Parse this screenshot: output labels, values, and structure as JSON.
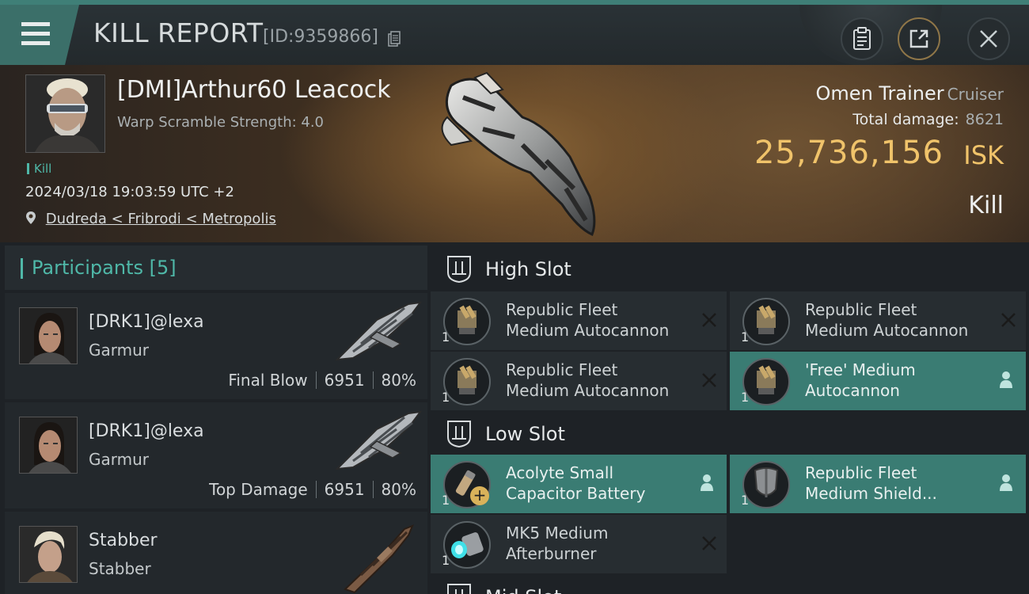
{
  "header": {
    "title": "KILL REPORT",
    "id_text": "[ID:9359866]"
  },
  "victim": {
    "name": "[DMI]Arthur60 Leacock",
    "warp_scramble": "Warp Scramble Strength: 4.0",
    "tag": "Kill",
    "datetime": "2024/03/18 19:03:59 UTC +2",
    "location": "Dudreda < Fribrodi < Metropolis",
    "ship": "Omen Trainer",
    "ship_class": "Cruiser",
    "total_damage_label": "Total damage:",
    "total_damage": "8621",
    "isk_value": "25,736,156",
    "isk_unit": "ISK",
    "result": "Kill"
  },
  "participants": {
    "title": "Participants",
    "count": "[5]",
    "rows": [
      {
        "name": "[DRK1]@lexa",
        "ship": "Garmur",
        "role": "Final Blow",
        "damage": "6951",
        "percent": "80%"
      },
      {
        "name": "[DRK1]@lexa",
        "ship": "Garmur",
        "role": "Top Damage",
        "damage": "6951",
        "percent": "80%"
      },
      {
        "name": "Stabber",
        "ship": "Stabber",
        "role": "",
        "damage": "",
        "percent": ""
      }
    ]
  },
  "slots": {
    "high_title": "High Slot",
    "low_title": "Low Slot",
    "mid_title": "Mid Slot",
    "high": [
      {
        "qty": "1",
        "line1": "Republic Fleet",
        "line2": "Medium Autocannon",
        "state": "destroyed"
      },
      {
        "qty": "1",
        "line1": "Republic Fleet",
        "line2": "Medium Autocannon",
        "state": "destroyed"
      },
      {
        "qty": "1",
        "line1": "Republic Fleet",
        "line2": "Medium Autocannon",
        "state": "destroyed"
      },
      {
        "qty": "1",
        "line1": "'Free' Medium",
        "line2": "Autocannon",
        "state": "dropped"
      }
    ],
    "low": [
      {
        "qty": "1",
        "line1": "Acolyte Small",
        "line2": "Capacitor Battery",
        "state": "dropped"
      },
      {
        "qty": "1",
        "line1": "Republic Fleet",
        "line2": "Medium Shield...",
        "state": "dropped"
      },
      {
        "qty": "1",
        "line1": "MK5 Medium",
        "line2": "Afterburner",
        "state": "destroyed"
      }
    ]
  },
  "colors": {
    "accent_teal": "#4fb8a8",
    "isk_gold": "#f0c36a",
    "dropped_bg": "#3a7c73"
  }
}
